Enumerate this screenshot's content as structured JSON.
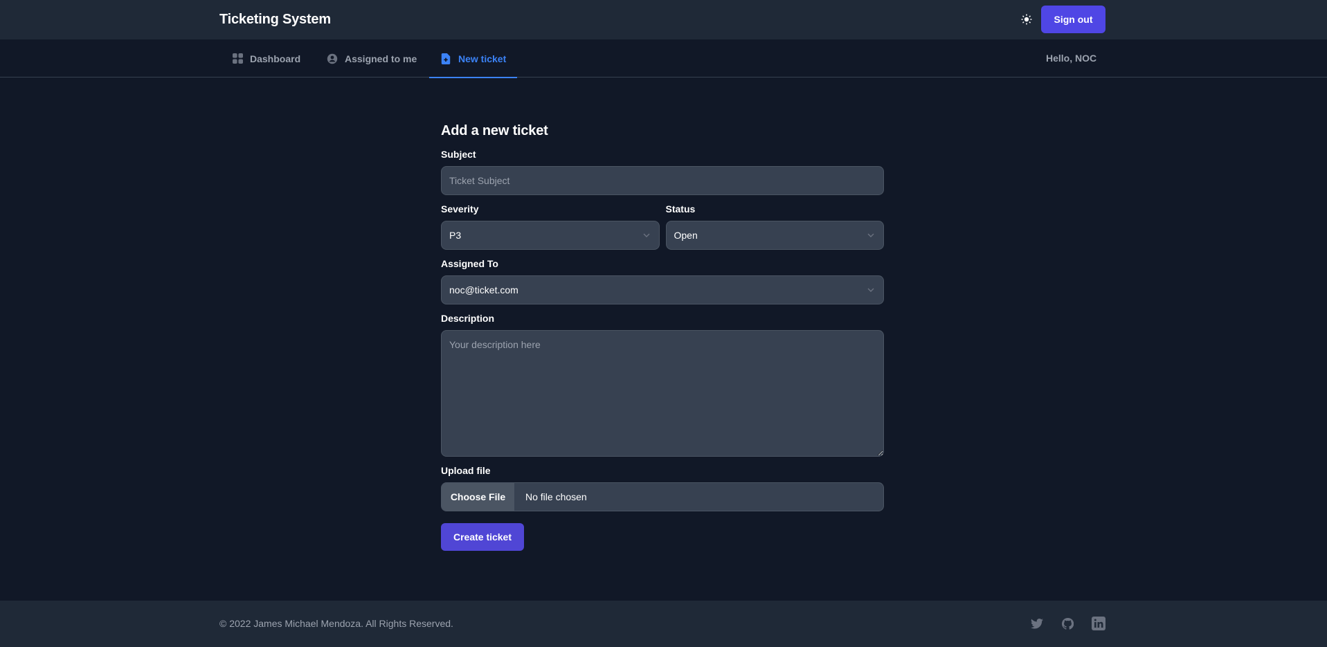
{
  "header": {
    "brand": "Ticketing System",
    "theme_toggle_icon": "sun-icon",
    "signout_label": "Sign out"
  },
  "nav": {
    "tabs": [
      {
        "label": "Dashboard",
        "icon": "grid-icon",
        "active": false
      },
      {
        "label": "Assigned to me",
        "icon": "user-circle-icon",
        "active": false
      },
      {
        "label": "New ticket",
        "icon": "document-add-icon",
        "active": true
      }
    ],
    "greeting": "Hello, NOC"
  },
  "form": {
    "title": "Add a new ticket",
    "subject": {
      "label": "Subject",
      "placeholder": "Ticket Subject",
      "value": ""
    },
    "severity": {
      "label": "Severity",
      "value": "P3"
    },
    "status": {
      "label": "Status",
      "value": "Open"
    },
    "assigned_to": {
      "label": "Assigned To",
      "value": "noc@ticket.com"
    },
    "description": {
      "label": "Description",
      "placeholder": "Your description here",
      "value": ""
    },
    "upload": {
      "label": "Upload file",
      "button": "Choose File",
      "status": "No file chosen"
    },
    "submit_label": "Create ticket"
  },
  "footer": {
    "copyright": "© 2022 James Michael Mendoza. All Rights Reserved.",
    "social": [
      "twitter-icon",
      "github-icon",
      "linkedin-icon"
    ]
  },
  "colors": {
    "accent": "#4f46e5",
    "active_tab": "#3b82f6",
    "background": "#111827",
    "surface": "#1f2937",
    "input": "#374151"
  }
}
